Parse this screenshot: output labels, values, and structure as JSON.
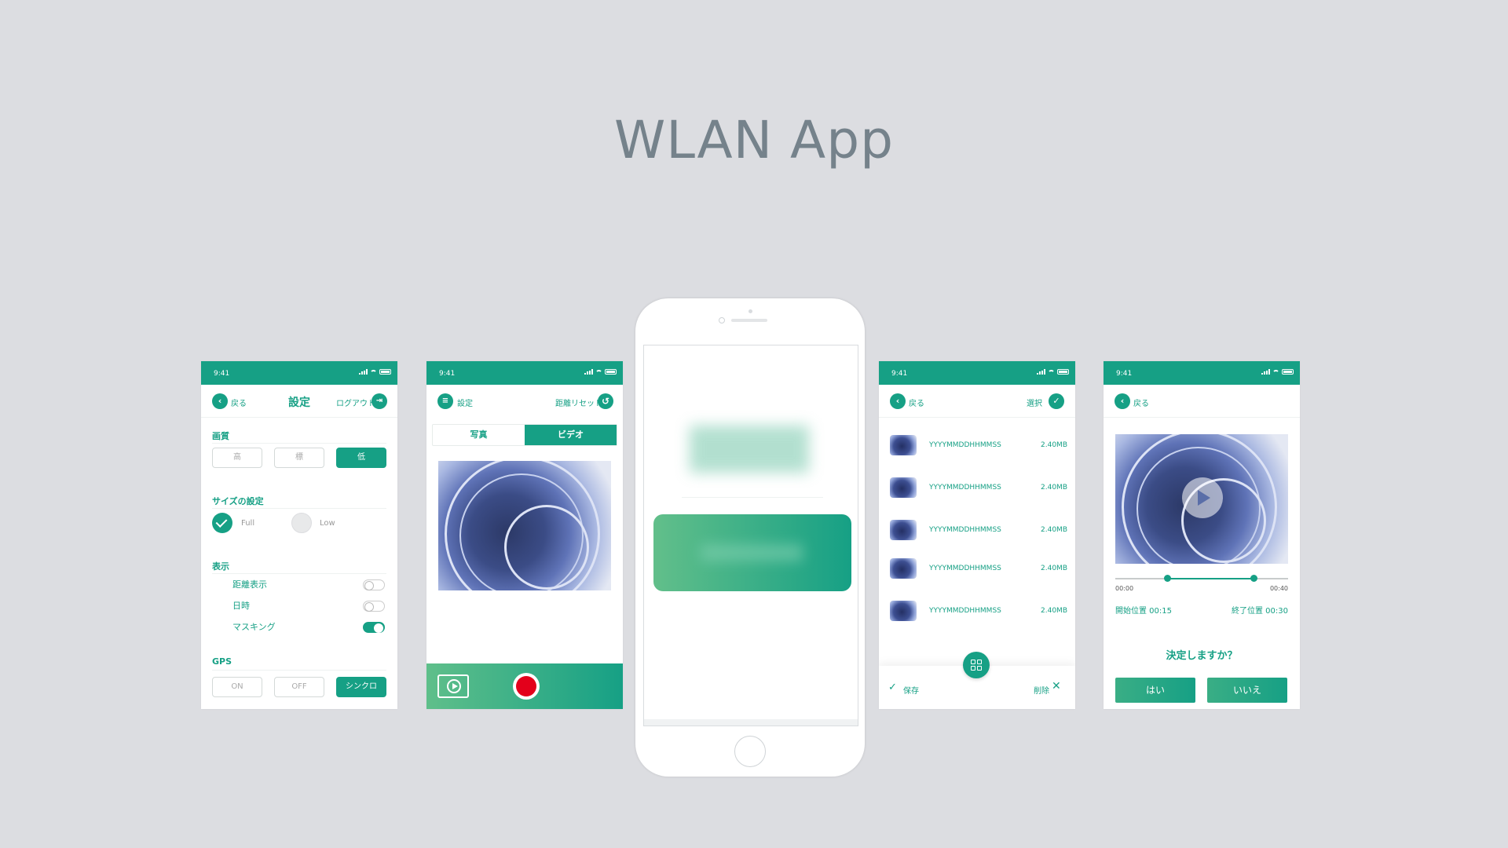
{
  "page": {
    "title": "WLAN App"
  },
  "status_time": "9:41",
  "screen1": {
    "back_label": "戻る",
    "title": "設定",
    "logout_label": "ログアウト",
    "quality": {
      "title": "画質",
      "options": [
        "高",
        "標",
        "低"
      ],
      "selected": "低"
    },
    "size": {
      "title": "サイズの設定",
      "options": [
        "Full",
        "Low"
      ],
      "selected": "Full"
    },
    "display": {
      "title": "表示",
      "items": [
        {
          "label": "距離表示",
          "on": false
        },
        {
          "label": "日時",
          "on": false
        },
        {
          "label": "マスキング",
          "on": true
        }
      ]
    },
    "gps": {
      "title": "GPS",
      "options": [
        "ON",
        "OFF",
        "シンクロ"
      ],
      "selected": "シンクロ"
    }
  },
  "screen2": {
    "settings_label": "設定",
    "reset_label": "距離リセット",
    "tabs": [
      "写真",
      "ビデオ"
    ],
    "active_tab": "ビデオ"
  },
  "screen4": {
    "back_label": "戻る",
    "select_label": "選択",
    "files": [
      {
        "name": "YYYYMMDDHHMMSS",
        "size": "2.40MB"
      },
      {
        "name": "YYYYMMDDHHMMSS",
        "size": "2.40MB"
      },
      {
        "name": "YYYYMMDDHHMMSS",
        "size": "2.40MB"
      },
      {
        "name": "YYYYMMDDHHMMSS",
        "size": "2.40MB"
      },
      {
        "name": "YYYYMMDDHHMMSS",
        "size": "2.40MB"
      }
    ],
    "save_label": "保存",
    "delete_label": "削除"
  },
  "screen5": {
    "back_label": "戻る",
    "time_start": "00:00",
    "time_end": "00:40",
    "start_pos": "開始位置 00:15",
    "end_pos": "終了位置 00:30",
    "trim_range": [
      0.3,
      0.8
    ],
    "confirm_question": "決定しますか？",
    "yes_label": "はい",
    "no_label": "いいえ"
  },
  "colors": {
    "accent": "#16a085",
    "accent_light": "#5fbf8a",
    "record": "#e3001b",
    "background": "#dcdde1"
  }
}
